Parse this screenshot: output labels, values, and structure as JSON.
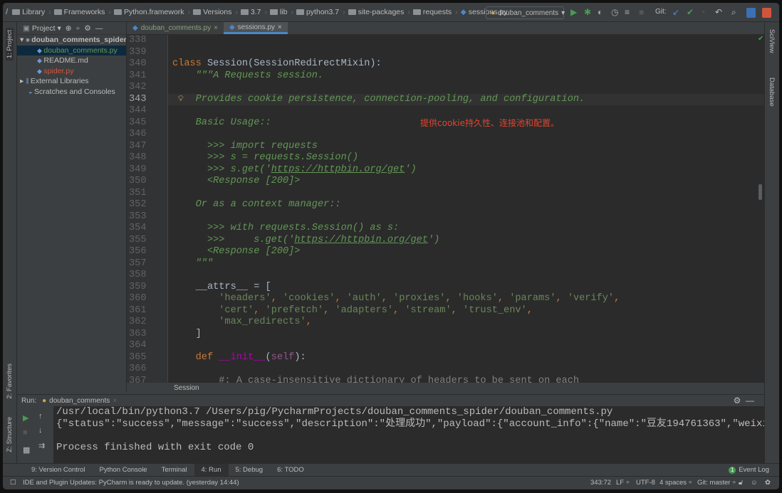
{
  "breadcrumbs": [
    "Library",
    "Frameworks",
    "Python.framework",
    "Versions",
    "3.7",
    "lib",
    "python3.7",
    "site-packages",
    "requests",
    "sessions.py"
  ],
  "toolbar": {
    "run_config": "douban_comments",
    "git_label": "Git:"
  },
  "left_strip": {
    "project": "1: Project",
    "favorites": "2: Favorites",
    "structure": "Z: Structure"
  },
  "right_strip": {
    "sciview": "SciView",
    "database": "Database"
  },
  "project": {
    "title": "Project",
    "items": [
      {
        "label": "douban_comments_spider",
        "color": "#bbbbbb"
      },
      {
        "label": "douban_comments.py",
        "color": "#6a9955"
      },
      {
        "label": "README.md",
        "color": "#bbbbbb"
      },
      {
        "label": "spider.py",
        "color": "#d0573f"
      },
      {
        "label": "External Libraries",
        "color": "#bbbbbb"
      },
      {
        "label": "Scratches and Consoles",
        "color": "#bbbbbb"
      }
    ]
  },
  "tabs": [
    {
      "label": "douban_comments.py",
      "active": false
    },
    {
      "label": "sessions.py",
      "active": true
    }
  ],
  "editor": {
    "current_line": 343,
    "first_line": 338,
    "annotation": "提供cookie持久性、连接池和配置。",
    "lines": [
      [],
      [],
      [
        [
          "class",
          "kw"
        ],
        [
          " Session(SessionRedirectMixin):",
          "df"
        ]
      ],
      [
        [
          "    \"\"\"A Requests session.",
          "doc"
        ]
      ],
      [],
      [
        [
          "    Provides cookie persistence, connection-pooling, and configuration.",
          "doc"
        ]
      ],
      [],
      [
        [
          "    Basic Usage::",
          "doc"
        ]
      ],
      [],
      [
        [
          "      >>> import requests",
          "doc"
        ]
      ],
      [
        [
          "      >>> s = requests.Session()",
          "doc"
        ]
      ],
      [
        [
          "      >>> s.get('",
          "doc"
        ],
        [
          "https://httpbin.org/get",
          "lk"
        ],
        [
          "')",
          "doc"
        ]
      ],
      [
        [
          "      <Response [200]>",
          "doc"
        ]
      ],
      [],
      [
        [
          "    Or as a context manager::",
          "doc"
        ]
      ],
      [],
      [
        [
          "      >>> with requests.Session() as s:",
          "doc"
        ]
      ],
      [
        [
          "      >>>     s.get('",
          "doc"
        ],
        [
          "https://httpbin.org/get",
          "lk"
        ],
        [
          "')",
          "doc"
        ]
      ],
      [
        [
          "      <Response [200]>",
          "doc"
        ]
      ],
      [
        [
          "    \"\"\"",
          "doc"
        ]
      ],
      [],
      [
        [
          "    __attrs__ = [",
          "df"
        ]
      ],
      [
        [
          "        ",
          "df"
        ],
        [
          "'headers'",
          "str"
        ],
        [
          ", ",
          "kw"
        ],
        [
          "'cookies'",
          "str"
        ],
        [
          ", ",
          "kw"
        ],
        [
          "'auth'",
          "str"
        ],
        [
          ", ",
          "kw"
        ],
        [
          "'proxies'",
          "str"
        ],
        [
          ", ",
          "kw"
        ],
        [
          "'hooks'",
          "str"
        ],
        [
          ", ",
          "kw"
        ],
        [
          "'params'",
          "str"
        ],
        [
          ", ",
          "kw"
        ],
        [
          "'verify'",
          "str"
        ],
        [
          ",",
          "kw"
        ]
      ],
      [
        [
          "        ",
          "df"
        ],
        [
          "'cert'",
          "str"
        ],
        [
          ", ",
          "kw"
        ],
        [
          "'prefetch'",
          "str"
        ],
        [
          ", ",
          "kw"
        ],
        [
          "'adapters'",
          "str"
        ],
        [
          ", ",
          "kw"
        ],
        [
          "'stream'",
          "str"
        ],
        [
          ", ",
          "kw"
        ],
        [
          "'trust_env'",
          "str"
        ],
        [
          ",",
          "kw"
        ]
      ],
      [
        [
          "        ",
          "df"
        ],
        [
          "'max_redirects'",
          "str"
        ],
        [
          ",",
          "kw"
        ]
      ],
      [
        [
          "    ]",
          "df"
        ]
      ],
      [],
      [
        [
          "    def ",
          "kw"
        ],
        [
          "__init__",
          "mag"
        ],
        [
          "(",
          "df"
        ],
        [
          "self",
          "slf"
        ],
        [
          "):",
          "df"
        ]
      ],
      [],
      [
        [
          "        #: A case-insensitive dictionary of headers to be sent on each",
          "cm"
        ]
      ]
    ]
  },
  "editor_breadcrumb": "Session",
  "run": {
    "label": "Run:",
    "tab": "douban_comments",
    "output": [
      "/usr/local/bin/python3.7 /Users/pig/PycharmProjects/douban_comments_spider/douban_comments.py",
      "{\"status\":\"success\",\"message\":\"success\",\"description\":\"处理成功\",\"payload\":{\"account_info\":{\"name\":\"豆友194761363\",\"weixin_",
      "",
      "Process finished with exit code 0"
    ]
  },
  "bottom_tabs": [
    {
      "label": "9: Version Control",
      "active": false
    },
    {
      "label": "Python Console",
      "active": false
    },
    {
      "label": "Terminal",
      "active": false
    },
    {
      "label": "4: Run",
      "active": true
    },
    {
      "label": "5: Debug",
      "active": false
    },
    {
      "label": "6: TODO",
      "active": false
    }
  ],
  "event_log": {
    "count": "1",
    "label": "Event Log"
  },
  "status": {
    "message": "IDE and Plugin Updates: PyCharm is ready to update. (yesterday 14:44)",
    "position": "343:72",
    "line_sep": "LF ÷",
    "encoding": "UTF-8",
    "indent": "4 spaces ÷",
    "git": "Git: master ÷"
  },
  "colors": {
    "keyword": "#cc7832",
    "docstring": "#629755",
    "string": "#6a8759",
    "annotation": "#e0452f",
    "accent": "#4a88c7"
  }
}
